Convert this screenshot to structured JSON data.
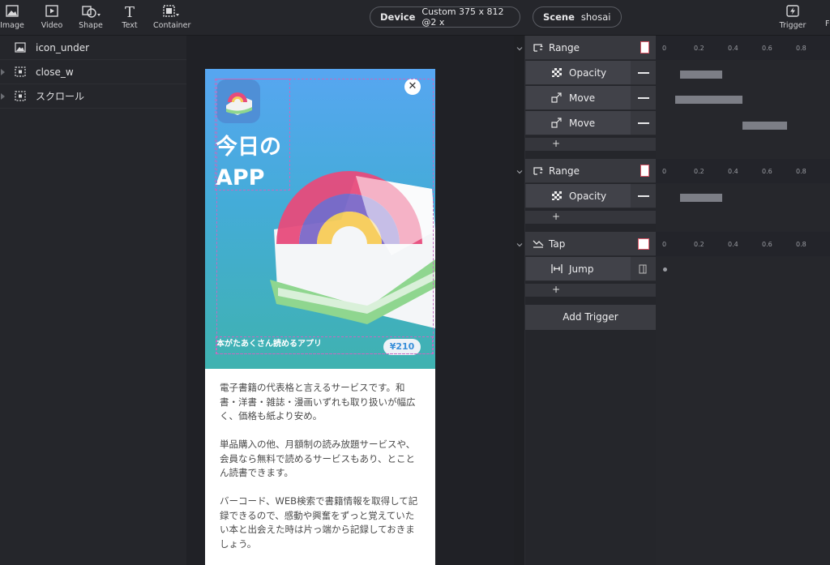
{
  "toolbar": {
    "tools": [
      {
        "label": "Image",
        "icon": "image-icon"
      },
      {
        "label": "Video",
        "icon": "video-icon"
      },
      {
        "label": "Shape",
        "icon": "shape-icon"
      },
      {
        "label": "Text",
        "icon": "text-icon"
      },
      {
        "label": "Container",
        "icon": "container-icon"
      }
    ],
    "device_label": "Device",
    "device_value": "Custom  375 x 812  @2 x",
    "scene_label": "Scene",
    "scene_value": "shosai",
    "trigger_label": "Trigger"
  },
  "layers": [
    {
      "name": "icon_under",
      "icon": "image-icon"
    },
    {
      "name": "close_w",
      "icon": "container-icon"
    },
    {
      "name": "スクロール",
      "icon": "container-icon"
    }
  ],
  "preview": {
    "hero_title_1": "今日の",
    "hero_title_2": "APP",
    "close_glyph": "✕",
    "subtitle": "本がたあくさん読めるアプリ",
    "price": "¥210",
    "paragraphs": [
      "電子書籍の代表格と言えるサービスです。和書・洋書・雑誌・漫画いずれも取り扱いが幅広く、価格も紙より安め。",
      "単品購入の他、月額制の読み放題サービスや、会員なら無料で読めるサービスもあり、とことん読書できます。",
      "バーコード、WEB検索で書籍情報を取得して記録できるので、感動や興奮をずっと覚えていたい本と出会えた時は片っ端から記録しておきましょう。"
    ]
  },
  "timeline": {
    "ruler_ticks": [
      "0",
      "0.2",
      "0.4",
      "0.6",
      "0.8"
    ],
    "groups": [
      {
        "trigger": "Range",
        "icon": "range-icon",
        "actions": [
          {
            "label": "Opacity",
            "icon": "opacity-icon",
            "bar_start": 0.1,
            "bar_end": 0.35
          },
          {
            "label": "Move",
            "icon": "move-icon",
            "bar_start": 0.07,
            "bar_end": 0.47
          },
          {
            "label": "Move",
            "icon": "move-icon",
            "bar_start": 0.47,
            "bar_end": 0.73
          }
        ]
      },
      {
        "trigger": "Range",
        "icon": "range-icon",
        "actions": [
          {
            "label": "Opacity",
            "icon": "opacity-icon",
            "bar_start": 0.1,
            "bar_end": 0.35
          }
        ]
      },
      {
        "trigger": "Tap",
        "icon": "tap-icon",
        "actions": [
          {
            "label": "Jump",
            "icon": "jump-icon"
          }
        ]
      }
    ],
    "add_label": "+",
    "add_trigger_label": "Add Trigger"
  }
}
